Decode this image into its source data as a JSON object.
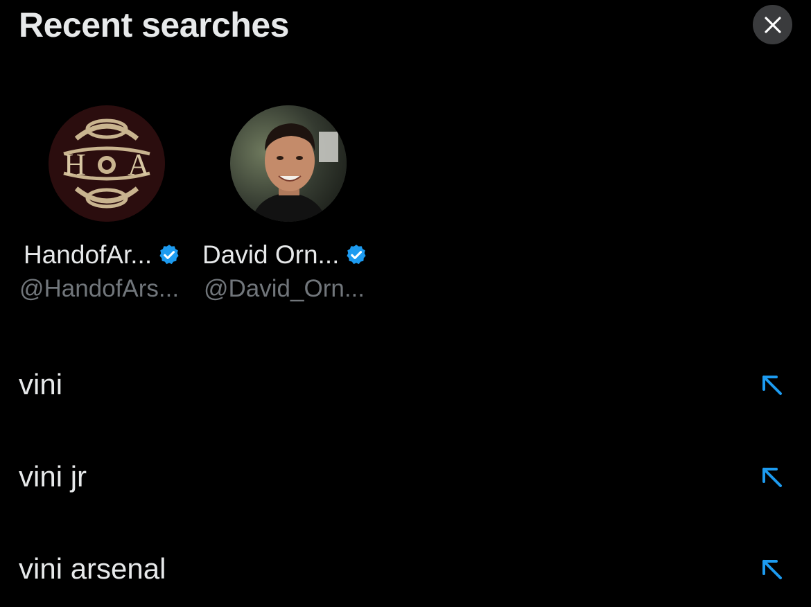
{
  "header": {
    "title": "Recent searches",
    "close_icon": "close-icon"
  },
  "accounts": [
    {
      "name": "HandofAr...",
      "handle": "@HandofArs...",
      "verified": true,
      "avatar": "HoA crest logo avatar",
      "avatar_text": "H A"
    },
    {
      "name": "David Orn...",
      "handle": "@David_Orn...",
      "verified": true,
      "avatar": "profile photo avatar"
    }
  ],
  "searches": [
    {
      "term": "vini",
      "icon": "arrow-up-left-icon"
    },
    {
      "term": "vini jr",
      "icon": "arrow-up-left-icon"
    },
    {
      "term": "vini arsenal",
      "icon": "arrow-up-left-icon"
    }
  ],
  "colors": {
    "background": "#000000",
    "text_primary": "#e7e9ea",
    "text_secondary": "#71767b",
    "accent_blue": "#1d9bf0",
    "close_button_bg": "#3a3b3d"
  }
}
